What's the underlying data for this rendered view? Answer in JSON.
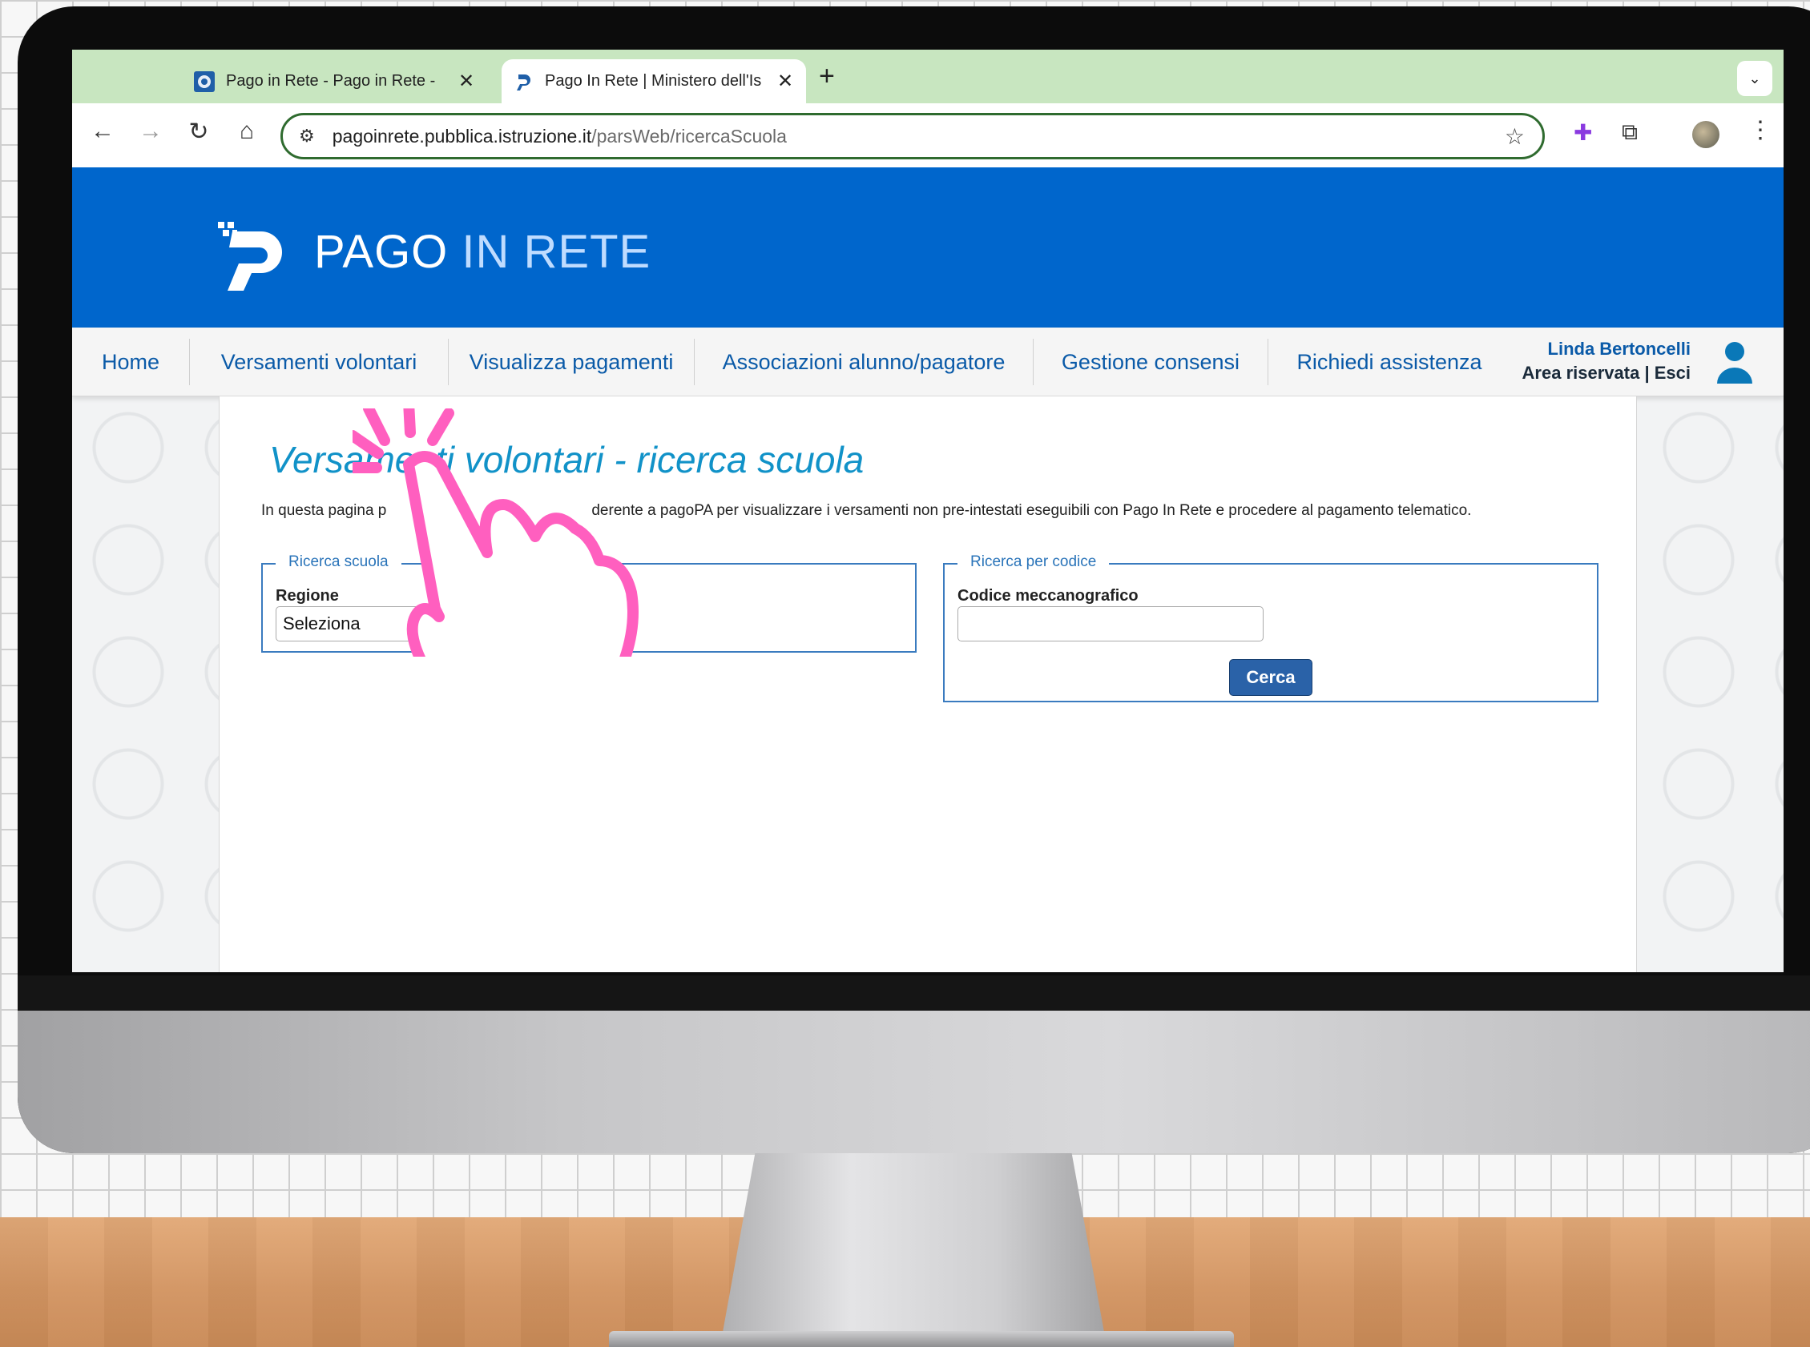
{
  "browser": {
    "tabs": [
      {
        "title": "Pago in Rete - Pago in Rete -",
        "active": false
      },
      {
        "title": "Pago In Rete | Ministero dell'Is",
        "active": true
      }
    ],
    "new_tab": "+",
    "tab_menu": "⌄",
    "url_host": "pagoinrete.pubblica.istruzione.it",
    "url_path": "/parsWeb/ricercaScuola"
  },
  "header": {
    "brand_part1": "PAGO",
    "brand_part2": "IN RETE",
    "accent_color": "#0066cc"
  },
  "nav": {
    "items": [
      "Home",
      "Versamenti volontari",
      "Visualizza pagamenti",
      "Associazioni alunno/pagatore",
      "Gestione consensi",
      "Richiedi assistenza"
    ],
    "user_name": "Linda Bertoncelli",
    "area_label": "Area riservata",
    "separator": "|",
    "logout_label": "Esci"
  },
  "content": {
    "title": "Versamenti volontari - ricerca scuola",
    "intro_visible_start": "In questa pagina p",
    "intro_visible_end": "derente a pagoPA per visualizzare i versamenti non pre-intestati eseguibili con Pago In Rete e procedere al pagamento telematico.",
    "search_school": {
      "legend": "Ricerca scuola",
      "region_label": "Regione",
      "region_value": "Seleziona"
    },
    "search_code": {
      "legend": "Ricerca per codice",
      "code_label": "Codice meccanografico",
      "code_value": "",
      "submit_label": "Cerca"
    }
  },
  "overlay": {
    "pointer_icon": "tap-hand-icon",
    "color": "#ff5fbf"
  }
}
